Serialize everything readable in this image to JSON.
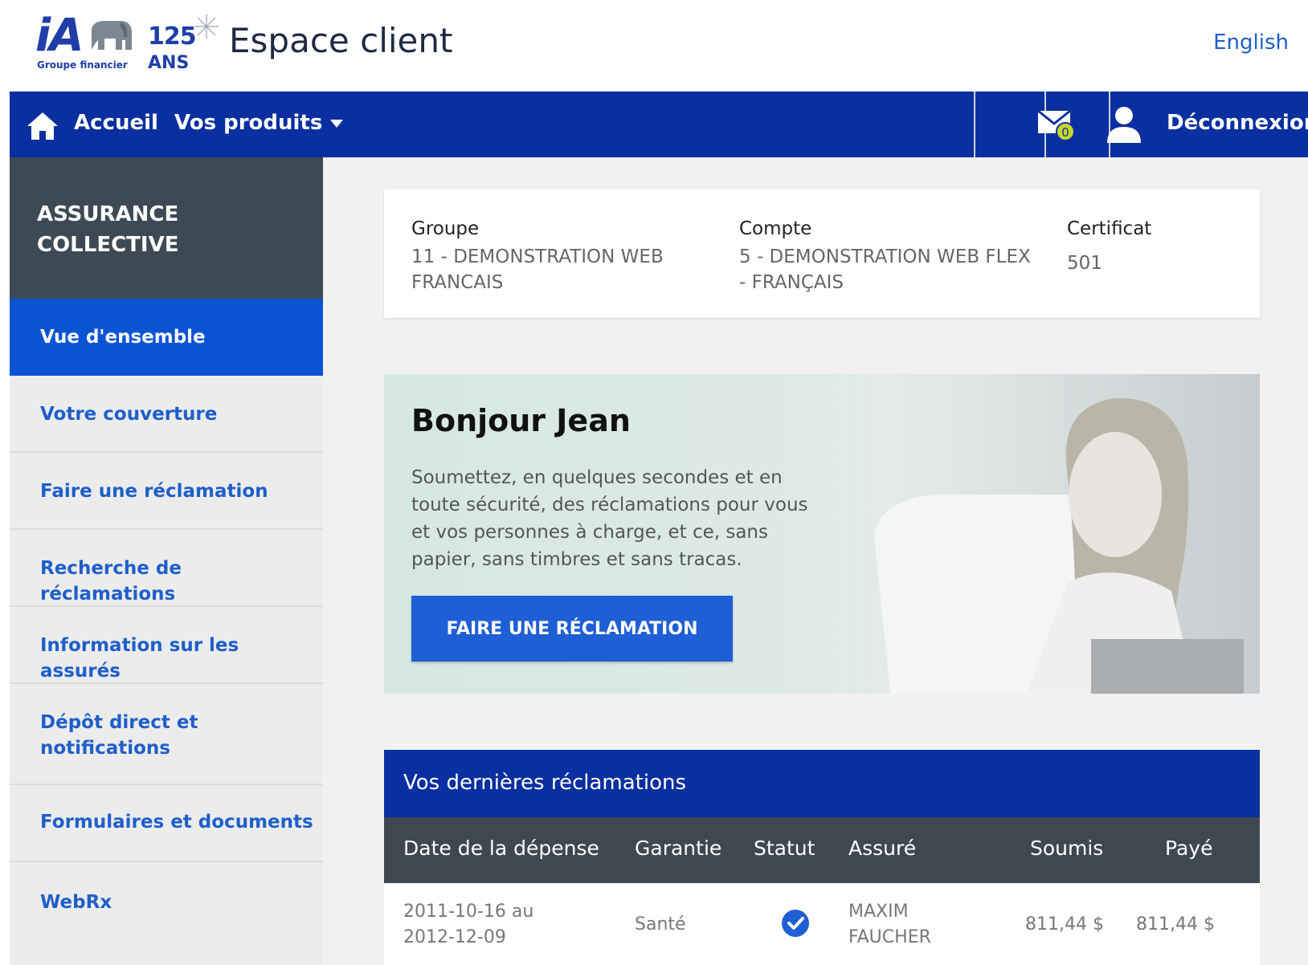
{
  "header": {
    "logo_ia": "iA",
    "logo_125": "125",
    "logo_ans": "ANS",
    "logo_groupe": "Groupe financier",
    "app_title": "Espace client",
    "language_link": "English"
  },
  "navbar": {
    "home_label": "Accueil",
    "products_label": "Vos produits",
    "mail_count": "0",
    "logout_label": "Déconnexion",
    "colors": {
      "background": "#0a2fa0",
      "badge": "#c8d62b"
    }
  },
  "sidebar": {
    "section_title": "ASSURANCE COLLECTIVE",
    "items": [
      {
        "label": "Vue d'ensemble",
        "active": true
      },
      {
        "label": "Votre couverture"
      },
      {
        "label": "Faire une réclamation"
      },
      {
        "label": "Recherche de réclamations"
      },
      {
        "label": "Information sur les assurés"
      },
      {
        "label": "Dépôt direct et notifications"
      },
      {
        "label": "Formulaires et documents"
      },
      {
        "label": "WebRx"
      }
    ]
  },
  "info": {
    "groupe_label": "Groupe",
    "groupe_value": "11 - DEMONSTRATION WEB FRANCAIS",
    "compte_label": "Compte",
    "compte_value": "5 - DEMONSTRATION WEB FLEX - FRANÇAIS",
    "certificat_label": "Certificat",
    "certificat_value": "501"
  },
  "hero": {
    "greeting": "Bonjour Jean",
    "text": "Soumettez, en quelques secondes et en toute sécurité, des réclamations pour vous et vos personnes à charge, et ce, sans papier, sans timbres et sans tracas.",
    "button_label": "FAIRE UNE RÉCLAMATION"
  },
  "claims": {
    "title": "Vos dernières réclamations",
    "columns": [
      "Date de la dépense",
      "Garantie",
      "Statut",
      "Assuré",
      "Soumis",
      "Payé"
    ],
    "rows": [
      {
        "date": "2011-10-16 au 2012-12-09",
        "garantie": "Santé",
        "statut": "check-circle-icon",
        "assure": "MAXIM FAUCHER",
        "soumis": "811,44 $",
        "paye": "811,44 $"
      }
    ]
  }
}
